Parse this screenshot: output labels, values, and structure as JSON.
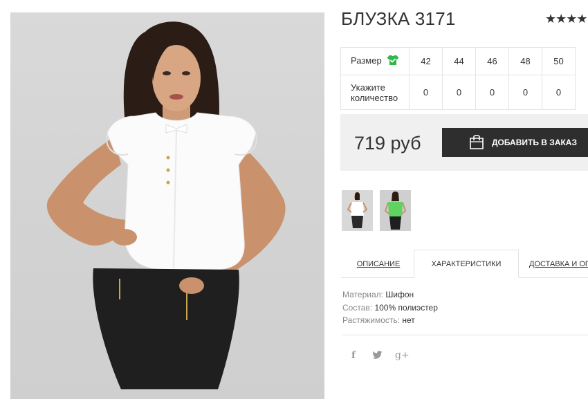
{
  "product": {
    "title": "БЛУЗКА 3171",
    "rating_stars": "★★★★",
    "rating_value": 4
  },
  "sizes_table": {
    "size_label": "Размер",
    "quantity_label_1": "Укажите",
    "quantity_label_2": "количество",
    "sizes": [
      "42",
      "44",
      "46",
      "48",
      "50"
    ],
    "quantities": [
      "0",
      "0",
      "0",
      "0",
      "0"
    ],
    "size_icon": "tshirt-check-icon",
    "size_icon_color": "#2db84a"
  },
  "order": {
    "price": "719 руб",
    "button_label": "ДОБАВИТЬ В ЗАКАЗ",
    "button_icon": "shopping-bag-icon"
  },
  "thumbnails": [
    {
      "name": "white-blouse",
      "color": "#ffffff"
    },
    {
      "name": "green-blouse",
      "color": "#5fd35f"
    }
  ],
  "tabs": {
    "description": "ОПИСАНИЕ",
    "characteristics": "ХАРАКТЕРИСТИКИ",
    "delivery": "ДОСТАВКА И ОП",
    "active": "characteristics"
  },
  "specs": {
    "material_key": "Материал:",
    "material_val": "Шифон",
    "composition_key": "Состав:",
    "composition_val": "100% полиэстер",
    "stretch_key": "Растяжимость:",
    "stretch_val": "нет"
  },
  "social": {
    "facebook": "f",
    "twitter": "twitter-icon",
    "googleplus": "g+"
  }
}
